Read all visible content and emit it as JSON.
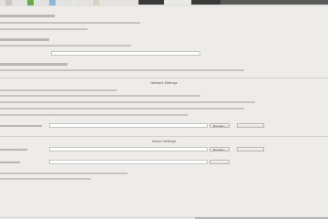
{
  "tabs": [
    {
      "state": "active"
    },
    {
      "state": "dark"
    }
  ],
  "toolbar": {
    "colors": [
      "#c9c7c2",
      "#6aa84f",
      "#8fb7d6",
      "#e7e4d9",
      "#d7d2c3"
    ]
  },
  "section_headers": [
    "Network Settings",
    "Import Settings"
  ],
  "buttons": [
    "Browse...",
    "Browse..."
  ]
}
